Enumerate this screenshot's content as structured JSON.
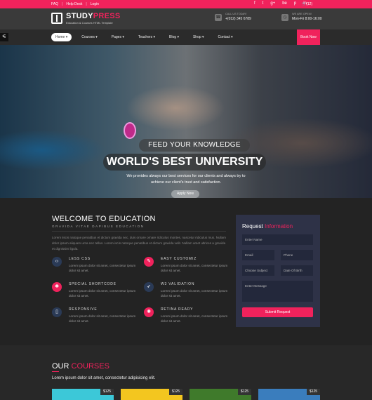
{
  "topbar": {
    "links": [
      "FAQ",
      "Help Desk",
      "Login"
    ],
    "separator": "|",
    "social": [
      "f",
      "t",
      "g+",
      "be",
      "p",
      "in"
    ],
    "cart": "(12)"
  },
  "header": {
    "logo": {
      "brand_a": "STUDY",
      "brand_b": "PRESS",
      "tagline": "Education & Courses HTML Template"
    },
    "call": {
      "label": "CALL US TODAY!",
      "value": "+(012) 345 6789"
    },
    "open": {
      "label": "WE ARE OPEN!",
      "value": "Mon-Fri 8:00-16:00"
    }
  },
  "nav": {
    "handle": "⚟",
    "items": [
      "Home ▾",
      "Courses ▾",
      "Pages ▾",
      "Teachers ▾",
      "Blog ▾",
      "Shop ▾",
      "Contact ▾"
    ],
    "book": "Book Now"
  },
  "hero": {
    "kicker": "FEED YOUR KNOWLEDGE",
    "title": "WORLD'S BEST UNIVERSITY",
    "desc": "We provides always our best services for our clients and always try to achieve our client's trust and satisfaction.",
    "button": "Apply Now"
  },
  "welcome": {
    "title": "WELCOME TO EDUCATION",
    "subtitle": "GRAVIDA VITAE DAPIBUS EDUCATION",
    "text": "Lorem iiscis natoque penatibus et dictum gravida nec, duis ornare ornare ridiculus montes, nascetur ridiculus mus. Nullam dolor ipsum aliquam urna nec tellus. Lorem iscis natoque penatibus et dictum gravida velit. Nullam amet ultrices a gravida et dignissim ligula.",
    "features": [
      {
        "title": "LESS CSS",
        "desc": "Lorem ipsum dolor sit amet, consectetur ipsum dolor sit amet.",
        "icon": "code-icon"
      },
      {
        "title": "EASY CUSTOMIZ",
        "desc": "Lorem ipsum dolor sit amet, consectetur ipsum dolor sit amet.",
        "icon": "brush-icon"
      },
      {
        "title": "SPECIAL SHORTCODE",
        "desc": "Lorem ipsum dolor sit amet, consectetur ipsum dolor sit amet.",
        "icon": "shortcode-icon"
      },
      {
        "title": "W3 VALIDATION",
        "desc": "Lorem ipsum dolor sit amet, consectetur ipsum dolor sit amet.",
        "icon": "rocket-icon"
      },
      {
        "title": "RESPONSIVE",
        "desc": "Lorem ipsum dolor sit amet, consectetur ipsum dolor sit amet.",
        "icon": "mobile-icon"
      },
      {
        "title": "RETINA READY",
        "desc": "Lorem ipsum dolor sit amet, consectetur ipsum dolor sit amet.",
        "icon": "bulb-icon"
      }
    ]
  },
  "form": {
    "title_a": "Request",
    "title_b": "Information",
    "name": "Enter Name",
    "email": "Email",
    "phone": "Phone",
    "subject": "Choose Subject",
    "dob": "Date Of Birth",
    "message": "Enter Message",
    "submit": "Submit Request"
  },
  "courses": {
    "title_a": "OUR",
    "title_b": "COURSES",
    "subtitle": "Lorem ipsum dolor sit amet, consectetur adipisicing elit.",
    "cards": [
      {
        "price": "$125",
        "color": "#3cc8d8"
      },
      {
        "price": "$125",
        "color": "#f3c61f"
      },
      {
        "price": "$125",
        "color": "#3f7a2b"
      },
      {
        "price": "$125",
        "color": "#3a7dbd"
      }
    ]
  },
  "colors": {
    "accent": "#f0225c",
    "navy": "#2a3a56",
    "dark": "#232323"
  }
}
